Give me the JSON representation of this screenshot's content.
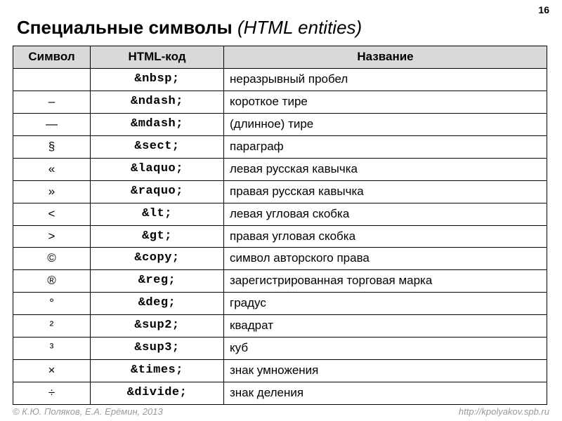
{
  "page_number": "16",
  "title": {
    "bold": "Специальные символы",
    "italic": "(HTML entities)"
  },
  "headers": {
    "symbol": "Символ",
    "code": "HTML-код",
    "name": "Название"
  },
  "rows": [
    {
      "symbol": "",
      "code": "&nbsp;",
      "name": "неразрывный пробел"
    },
    {
      "symbol": "–",
      "code": "&ndash;",
      "name": "короткое тире"
    },
    {
      "symbol": "—",
      "code": "&mdash;",
      "name": "(длинное) тире"
    },
    {
      "symbol": "§",
      "code": "&sect;",
      "name": "параграф"
    },
    {
      "symbol": "«",
      "code": "&laquo;",
      "name": "левая русская кавычка"
    },
    {
      "symbol": "»",
      "code": "&raquo;",
      "name": "правая русская кавычка"
    },
    {
      "symbol": "<",
      "code": "&lt;",
      "name": "левая угловая скобка"
    },
    {
      "symbol": ">",
      "code": "&gt;",
      "name": "правая угловая скобка"
    },
    {
      "symbol": "©",
      "code": "&copy;",
      "name": "символ авторского права"
    },
    {
      "symbol": "®",
      "code": "&reg;",
      "name": "зарегистрированная торговая марка"
    },
    {
      "symbol": "°",
      "code": "&deg;",
      "name": "градус"
    },
    {
      "symbol": "²",
      "code": "&sup2;",
      "name": "квадрат"
    },
    {
      "symbol": "³",
      "code": "&sup3;",
      "name": "куб"
    },
    {
      "symbol": "×",
      "code": "&times;",
      "name": "знак умножения"
    },
    {
      "symbol": "÷",
      "code": "&divide;",
      "name": "знак деления"
    }
  ],
  "footer": {
    "left": "© К.Ю. Поляков, Е.А. Ерёмин, 2013",
    "right": "http://kpolyakov.spb.ru"
  }
}
